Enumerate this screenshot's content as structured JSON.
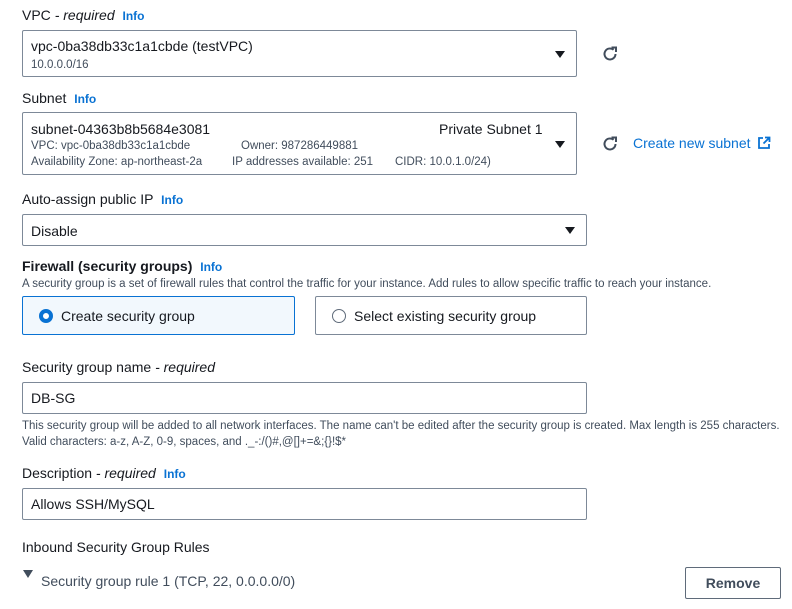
{
  "vpc": {
    "label": "VPC",
    "required": "- required",
    "info": "Info",
    "value": "vpc-0ba38db33c1a1cbde (testVPC)",
    "sub": "10.0.0.0/16"
  },
  "subnet": {
    "label": "Subnet",
    "info": "Info",
    "value": "subnet-04363b8b5684e3081",
    "name": "Private Subnet 1",
    "detail_vpc": "VPC: vpc-0ba38db33c1a1cbde",
    "detail_owner": "Owner: 987286449881",
    "detail_az": "Availability Zone: ap-northeast-2a",
    "detail_ips": "IP addresses available: 251",
    "detail_cidr": "CIDR: 10.0.1.0/24)",
    "create_link": "Create new subnet"
  },
  "auto_assign": {
    "label": "Auto-assign public IP",
    "info": "Info",
    "value": "Disable"
  },
  "firewall": {
    "label": "Firewall (security groups)",
    "info": "Info",
    "description": "A security group is a set of firewall rules that control the traffic for your instance. Add rules to allow specific traffic to reach your instance.",
    "option_create": "Create security group",
    "option_existing": "Select existing security group"
  },
  "sg_name": {
    "label": "Security group name",
    "required": "- required",
    "value": "DB-SG",
    "hint": "This security group will be added to all network interfaces. The name can't be edited after the security group is created. Max length is 255 characters. Valid characters: a-z, A-Z, 0-9, spaces, and ._-:/()#,@[]+=&;{}!$*"
  },
  "description": {
    "label": "Description",
    "required": "- required",
    "info": "Info",
    "value": "Allows SSH/MySQL"
  },
  "inbound": {
    "label": "Inbound Security Group Rules",
    "rule": "Security group rule 1 (TCP, 22, 0.0.0.0/0)",
    "remove": "Remove"
  }
}
